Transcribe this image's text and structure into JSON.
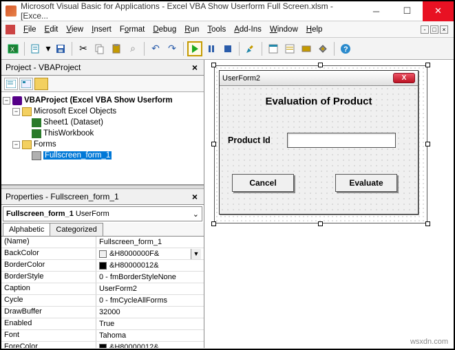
{
  "window": {
    "title": "Microsoft Visual Basic for Applications - Excel VBA Show Userform Full Screen.xlsm - [Exce..."
  },
  "menu": {
    "file": "File",
    "edit": "Edit",
    "view": "View",
    "insert": "Insert",
    "format": "Format",
    "debug": "Debug",
    "run": "Run",
    "tools": "Tools",
    "addins": "Add-Ins",
    "window": "Window",
    "help": "Help"
  },
  "project_panel": {
    "title": "Project - VBAProject",
    "root": "VBAProject (Excel VBA Show Userform",
    "excel_objects": "Microsoft Excel Objects",
    "sheet1": "Sheet1 (Dataset)",
    "thisworkbook": "ThisWorkbook",
    "forms_folder": "Forms",
    "form_item": "Fullscreen_form_1"
  },
  "properties_panel": {
    "title": "Properties - Fullscreen_form_1",
    "combo_name": "Fullscreen_form_1",
    "combo_type": "UserForm",
    "tab_alpha": "Alphabetic",
    "tab_cat": "Categorized",
    "rows": [
      {
        "name": "(Name)",
        "value": "Fullscreen_form_1"
      },
      {
        "name": "BackColor",
        "value": "&H8000000F&",
        "swatch": "#f0f0f0",
        "dropdown": true
      },
      {
        "name": "BorderColor",
        "value": "&H80000012&",
        "swatch": "#000000"
      },
      {
        "name": "BorderStyle",
        "value": "0 - fmBorderStyleNone"
      },
      {
        "name": "Caption",
        "value": "UserForm2"
      },
      {
        "name": "Cycle",
        "value": "0 - fmCycleAllForms"
      },
      {
        "name": "DrawBuffer",
        "value": "32000"
      },
      {
        "name": "Enabled",
        "value": "True"
      },
      {
        "name": "Font",
        "value": "Tahoma"
      },
      {
        "name": "ForeColor",
        "value": "&H80000012&",
        "swatch": "#000000"
      }
    ]
  },
  "userform": {
    "caption": "UserForm2",
    "heading": "Evaluation of Product",
    "label": "Product Id",
    "btn_cancel": "Cancel",
    "btn_evaluate": "Evaluate"
  },
  "watermark": "wsxdn.com"
}
